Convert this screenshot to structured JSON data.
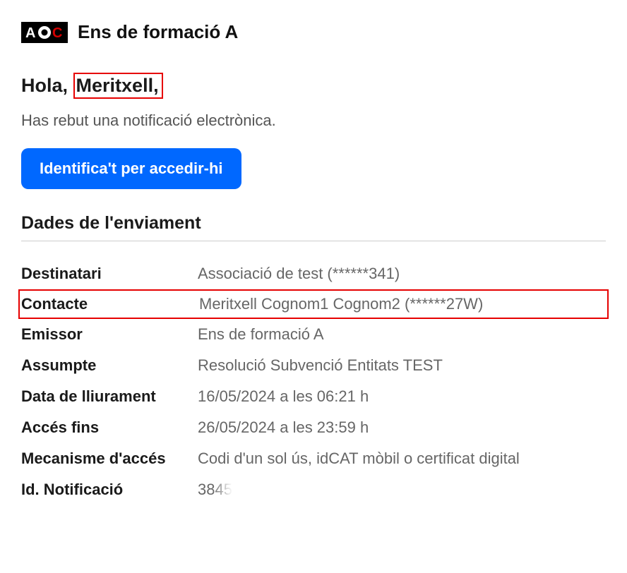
{
  "header": {
    "org_name": "Ens de formació A"
  },
  "greeting": {
    "prefix": "Hola,",
    "name": "Meritxell,"
  },
  "intro": "Has rebut una notificació electrònica.",
  "button": {
    "label": "Identifica't per accedir-hi"
  },
  "section_title": "Dades de l'enviament",
  "rows": {
    "destinatari": {
      "label": "Destinatari",
      "value": "Associació de test (******341)"
    },
    "contacte": {
      "label": "Contacte",
      "value": "Meritxell Cognom1 Cognom2 (******27W)"
    },
    "emissor": {
      "label": "Emissor",
      "value": "Ens de formació A"
    },
    "assumpte": {
      "label": "Assumpte",
      "value": "Resolució Subvenció Entitats TEST"
    },
    "lliurament": {
      "label": "Data de lliurament",
      "value": "16/05/2024 a les 06:21 h"
    },
    "acces_fins": {
      "label": "Accés fins",
      "value": "26/05/2024 a les 23:59 h"
    },
    "mecanisme": {
      "label": "Mecanisme d'accés",
      "value": "Codi d'un sol ús, idCAT mòbil o certificat digital"
    },
    "id_notif": {
      "label": "Id. Notificació",
      "value": "38455"
    }
  }
}
